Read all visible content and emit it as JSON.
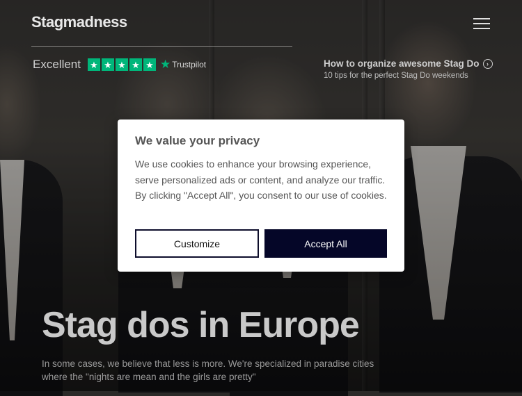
{
  "header": {
    "logo": "Stagmadness",
    "menu_icon": "hamburger-menu-icon"
  },
  "trustpilot": {
    "rating_word": "Excellent",
    "stars": 5,
    "star_glyph": "★",
    "brand": "Trustpilot",
    "brand_color": "#00b67a"
  },
  "promo": {
    "title": "How to organize awesome Stag Do",
    "subtitle": "10 tips for the perfect Stag Do weekends",
    "arrow_icon": "chevron-right-circle-icon"
  },
  "hero": {
    "title": "Stag dos in Europe",
    "text": "In some cases, we believe that less is more. We're specialized in paradise cities where the \"nights are mean and the girls are pretty\""
  },
  "cookie_modal": {
    "title": "We value your privacy",
    "body": "We use cookies to enhance your browsing experience, serve personalized ads or content, and analyze our traffic. By clicking \"Accept All\", you consent to our use of cookies.",
    "customize_label": "Customize",
    "accept_label": "Accept All",
    "accept_color": "#050628"
  }
}
